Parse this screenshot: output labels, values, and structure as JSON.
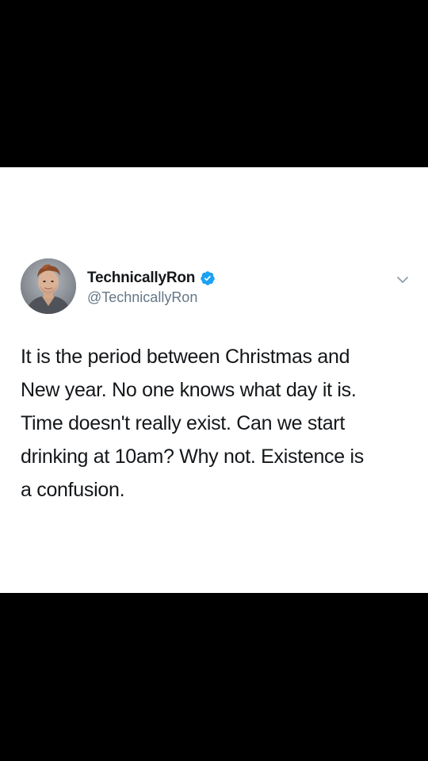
{
  "tweet": {
    "display_name": "TechnicallyRon",
    "handle": "@TechnicallyRon",
    "verified": true,
    "text_lines": [
      "It is the period between Christmas and",
      "New year. No one knows what day it is.",
      "Time doesn't really exist. Can we start",
      "drinking at 10am? Why not. Existence is",
      "a confusion."
    ]
  },
  "icons": {
    "verified": "verified-badge-icon",
    "menu": "chevron-down-icon",
    "avatar": "profile-photo"
  },
  "colors": {
    "background": "#000000",
    "card": "#ffffff",
    "text": "#14171a",
    "secondary_text": "#657786",
    "verified_blue": "#1da1f2"
  }
}
